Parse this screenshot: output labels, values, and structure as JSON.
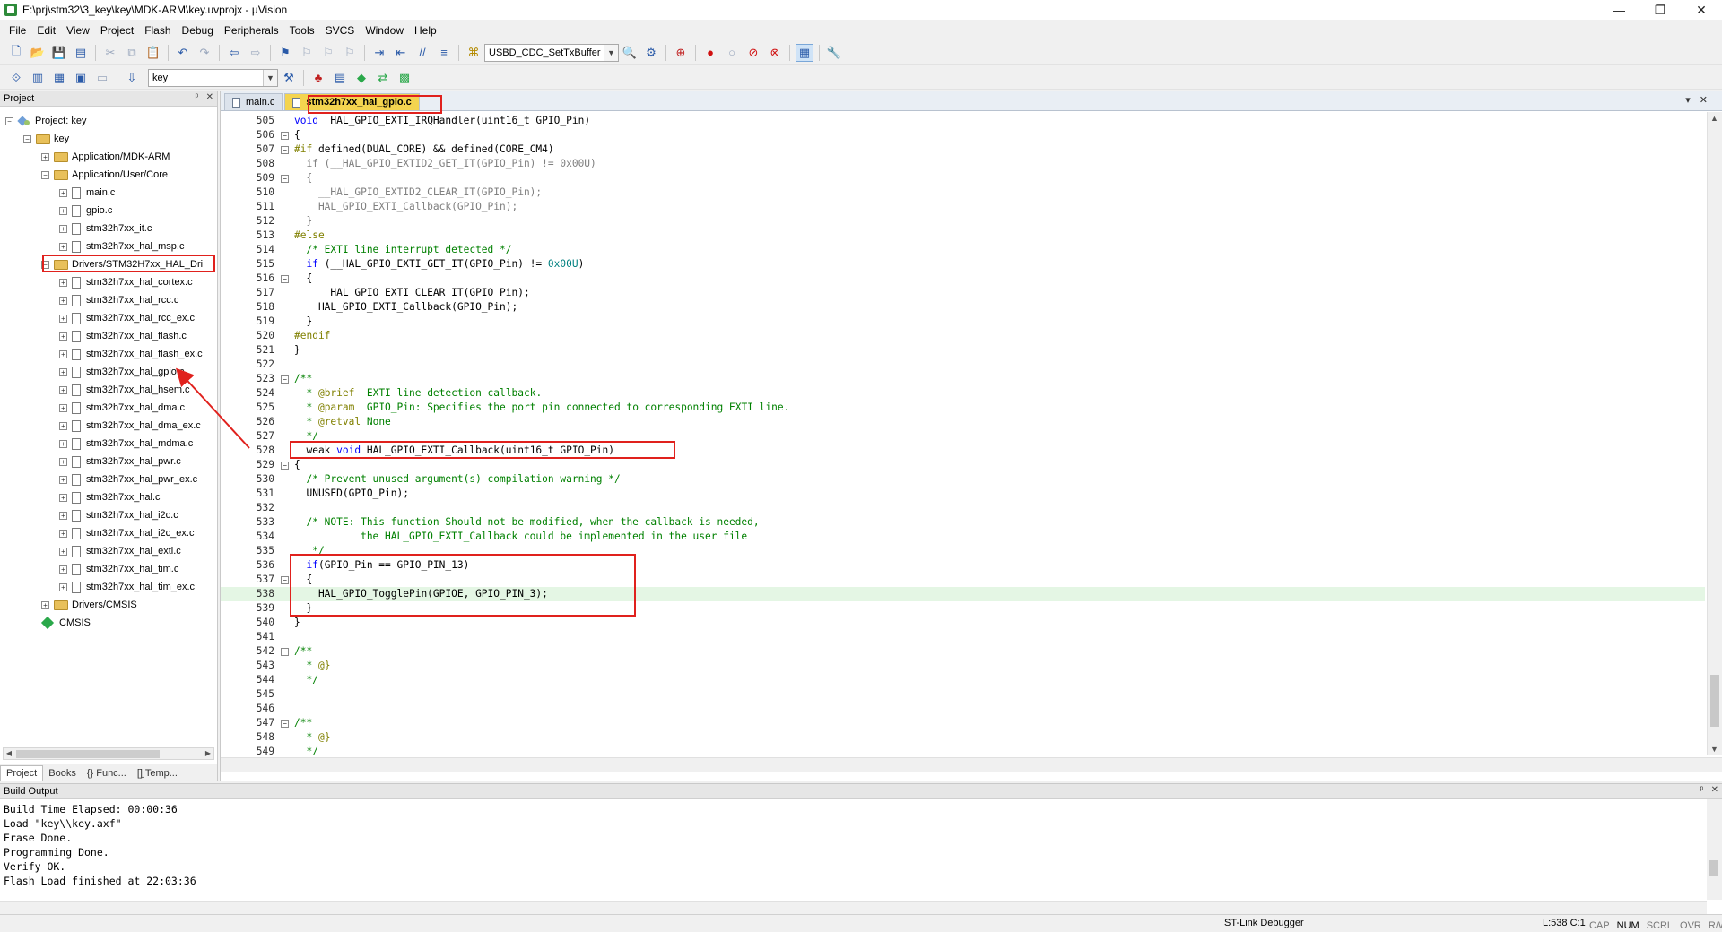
{
  "window": {
    "title": "E:\\prj\\stm32\\3_key\\key\\MDK-ARM\\key.uvprojx - µVision",
    "minimize": "—",
    "maximize": "❐",
    "close": "✕"
  },
  "menu": [
    "File",
    "Edit",
    "View",
    "Project",
    "Flash",
    "Debug",
    "Peripherals",
    "Tools",
    "SVCS",
    "Window",
    "Help"
  ],
  "toolbar": {
    "function_combo": "USBD_CDC_SetTxBuffer",
    "target_combo": "key"
  },
  "project_panel": {
    "title": "Project",
    "pin": "ᵖ",
    "close": "✕",
    "tree": [
      {
        "label": "Project: key",
        "type": "project",
        "level": 0,
        "expander": "−"
      },
      {
        "label": "key",
        "type": "target",
        "level": 1,
        "expander": "−"
      },
      {
        "label": "Application/MDK-ARM",
        "type": "folder",
        "level": 2,
        "expander": "+"
      },
      {
        "label": "Application/User/Core",
        "type": "folder",
        "level": 2,
        "expander": "−"
      },
      {
        "label": "main.c",
        "type": "file",
        "level": 3,
        "expander": "+"
      },
      {
        "label": "gpio.c",
        "type": "file",
        "level": 3,
        "expander": "+"
      },
      {
        "label": "stm32h7xx_it.c",
        "type": "file",
        "level": 3,
        "expander": "+"
      },
      {
        "label": "stm32h7xx_hal_msp.c",
        "type": "file",
        "level": 3,
        "expander": "+"
      },
      {
        "label": "Drivers/STM32H7xx_HAL_Dri",
        "type": "folder",
        "level": 2,
        "expander": "−"
      },
      {
        "label": "stm32h7xx_hal_cortex.c",
        "type": "file",
        "level": 3,
        "expander": "+"
      },
      {
        "label": "stm32h7xx_hal_rcc.c",
        "type": "file",
        "level": 3,
        "expander": "+"
      },
      {
        "label": "stm32h7xx_hal_rcc_ex.c",
        "type": "file",
        "level": 3,
        "expander": "+"
      },
      {
        "label": "stm32h7xx_hal_flash.c",
        "type": "file",
        "level": 3,
        "expander": "+"
      },
      {
        "label": "stm32h7xx_hal_flash_ex.c",
        "type": "file",
        "level": 3,
        "expander": "+"
      },
      {
        "label": "stm32h7xx_hal_gpio.c",
        "type": "file",
        "level": 3,
        "expander": "+"
      },
      {
        "label": "stm32h7xx_hal_hsem.c",
        "type": "file",
        "level": 3,
        "expander": "+"
      },
      {
        "label": "stm32h7xx_hal_dma.c",
        "type": "file",
        "level": 3,
        "expander": "+"
      },
      {
        "label": "stm32h7xx_hal_dma_ex.c",
        "type": "file",
        "level": 3,
        "expander": "+"
      },
      {
        "label": "stm32h7xx_hal_mdma.c",
        "type": "file",
        "level": 3,
        "expander": "+"
      },
      {
        "label": "stm32h7xx_hal_pwr.c",
        "type": "file",
        "level": 3,
        "expander": "+"
      },
      {
        "label": "stm32h7xx_hal_pwr_ex.c",
        "type": "file",
        "level": 3,
        "expander": "+"
      },
      {
        "label": "stm32h7xx_hal.c",
        "type": "file",
        "level": 3,
        "expander": "+"
      },
      {
        "label": "stm32h7xx_hal_i2c.c",
        "type": "file",
        "level": 3,
        "expander": "+"
      },
      {
        "label": "stm32h7xx_hal_i2c_ex.c",
        "type": "file",
        "level": 3,
        "expander": "+"
      },
      {
        "label": "stm32h7xx_hal_exti.c",
        "type": "file",
        "level": 3,
        "expander": "+"
      },
      {
        "label": "stm32h7xx_hal_tim.c",
        "type": "file",
        "level": 3,
        "expander": "+"
      },
      {
        "label": "stm32h7xx_hal_tim_ex.c",
        "type": "file",
        "level": 3,
        "expander": "+"
      },
      {
        "label": "Drivers/CMSIS",
        "type": "folder",
        "level": 2,
        "expander": "+"
      },
      {
        "label": "CMSIS",
        "type": "cmsis",
        "level": 2,
        "expander": ""
      }
    ],
    "tabs": [
      "Project",
      "Books",
      "{} Func...",
      "[]̱ Temp..."
    ]
  },
  "editor": {
    "tabs": [
      {
        "label": "main.c",
        "active": false
      },
      {
        "label": "stm32h7xx_hal_gpio.c",
        "active": true
      }
    ],
    "current_line": 538,
    "lines": [
      {
        "n": "505",
        "fold": "",
        "segs": [
          [
            "kw",
            "void"
          ],
          [
            "",
            "  HAL_GPIO_EXTI_IRQHandler(uint16_t GPIO_Pin)"
          ]
        ]
      },
      {
        "n": "506",
        "fold": "−",
        "segs": [
          [
            "",
            "{"
          ]
        ]
      },
      {
        "n": "507",
        "fold": "−",
        "segs": [
          [
            "pp",
            "#if"
          ],
          [
            "",
            " defined(DUAL_CORE) && defined(CORE_CM4)"
          ]
        ]
      },
      {
        "n": "508",
        "fold": "",
        "segs": [
          [
            "dimtxt",
            "  if (__HAL_GPIO_EXTID2_GET_IT(GPIO_Pin) != 0x00U)"
          ]
        ]
      },
      {
        "n": "509",
        "fold": "−",
        "segs": [
          [
            "dimtxt",
            "  {"
          ]
        ]
      },
      {
        "n": "510",
        "fold": "",
        "segs": [
          [
            "dimtxt",
            "    __HAL_GPIO_EXTID2_CLEAR_IT(GPIO_Pin);"
          ]
        ]
      },
      {
        "n": "511",
        "fold": "",
        "segs": [
          [
            "dimtxt",
            "    HAL_GPIO_EXTI_Callback(GPIO_Pin);"
          ]
        ]
      },
      {
        "n": "512",
        "fold": "",
        "segs": [
          [
            "dimtxt",
            "  }"
          ]
        ]
      },
      {
        "n": "513",
        "fold": "",
        "segs": [
          [
            "pp",
            "#else"
          ]
        ]
      },
      {
        "n": "514",
        "fold": "",
        "segs": [
          [
            "cm",
            "  /* EXTI line interrupt detected */"
          ]
        ]
      },
      {
        "n": "515",
        "fold": "",
        "segs": [
          [
            "kw",
            "  if"
          ],
          [
            "",
            " (__HAL_GPIO_EXTI_GET_IT(GPIO_Pin) != "
          ],
          [
            "num",
            "0x00U"
          ],
          [
            "",
            ")"
          ]
        ]
      },
      {
        "n": "516",
        "fold": "−",
        "segs": [
          [
            "",
            "  {"
          ]
        ]
      },
      {
        "n": "517",
        "fold": "",
        "segs": [
          [
            "",
            "    __HAL_GPIO_EXTI_CLEAR_IT(GPIO_Pin);"
          ]
        ]
      },
      {
        "n": "518",
        "fold": "",
        "segs": [
          [
            "",
            "    HAL_GPIO_EXTI_Callback(GPIO_Pin);"
          ]
        ]
      },
      {
        "n": "519",
        "fold": "",
        "segs": [
          [
            "",
            "  }"
          ]
        ]
      },
      {
        "n": "520",
        "fold": "",
        "segs": [
          [
            "pp",
            "#endif"
          ]
        ]
      },
      {
        "n": "521",
        "fold": "",
        "segs": [
          [
            "",
            "}"
          ]
        ]
      },
      {
        "n": "522",
        "fold": "",
        "segs": [
          [
            "",
            ""
          ]
        ]
      },
      {
        "n": "523",
        "fold": "−",
        "segs": [
          [
            "cm",
            "/**"
          ]
        ]
      },
      {
        "n": "524",
        "fold": "",
        "segs": [
          [
            "cm",
            "  * "
          ],
          [
            "pp",
            "@brief"
          ],
          [
            "cm",
            "  EXTI line detection callback."
          ]
        ]
      },
      {
        "n": "525",
        "fold": "",
        "segs": [
          [
            "cm",
            "  * "
          ],
          [
            "pp",
            "@param"
          ],
          [
            "cm",
            "  GPIO_Pin: Specifies the port pin connected to corresponding EXTI line."
          ]
        ]
      },
      {
        "n": "526",
        "fold": "",
        "segs": [
          [
            "cm",
            "  * "
          ],
          [
            "pp",
            "@retval"
          ],
          [
            "cm",
            " None"
          ]
        ]
      },
      {
        "n": "527",
        "fold": "",
        "segs": [
          [
            "cm",
            "  */"
          ]
        ]
      },
      {
        "n": "528",
        "fold": "",
        "segs": [
          [
            "",
            "  weak "
          ],
          [
            "kw",
            "void"
          ],
          [
            "",
            " HAL_GPIO_EXTI_Callback(uint16_t GPIO_Pin)"
          ]
        ]
      },
      {
        "n": "529",
        "fold": "−",
        "segs": [
          [
            "",
            "{"
          ]
        ]
      },
      {
        "n": "530",
        "fold": "",
        "segs": [
          [
            "cm",
            "  /* Prevent unused argument(s) compilation warning */"
          ]
        ]
      },
      {
        "n": "531",
        "fold": "",
        "segs": [
          [
            "",
            "  UNUSED(GPIO_Pin);"
          ]
        ]
      },
      {
        "n": "532",
        "fold": "",
        "segs": [
          [
            "",
            ""
          ]
        ]
      },
      {
        "n": "533",
        "fold": "",
        "segs": [
          [
            "cm",
            "  /* NOTE: This function Should not be modified, when the callback is needed,"
          ]
        ]
      },
      {
        "n": "534",
        "fold": "",
        "segs": [
          [
            "cm",
            "           the HAL_GPIO_EXTI_Callback could be implemented in the user file"
          ]
        ]
      },
      {
        "n": "535",
        "fold": "",
        "segs": [
          [
            "cm",
            "   */"
          ]
        ]
      },
      {
        "n": "536",
        "fold": "",
        "segs": [
          [
            "kw",
            "  if"
          ],
          [
            "",
            "(GPIO_Pin == GPIO_PIN_13)"
          ]
        ]
      },
      {
        "n": "537",
        "fold": "−",
        "segs": [
          [
            "",
            "  {"
          ]
        ]
      },
      {
        "n": "538",
        "fold": "",
        "segs": [
          [
            "",
            "    HAL_GPIO_TogglePin(GPIOE, GPIO_PIN_3);"
          ]
        ]
      },
      {
        "n": "539",
        "fold": "",
        "segs": [
          [
            "",
            "  }"
          ]
        ]
      },
      {
        "n": "540",
        "fold": "",
        "segs": [
          [
            "",
            "}"
          ]
        ]
      },
      {
        "n": "541",
        "fold": "",
        "segs": [
          [
            "",
            ""
          ]
        ]
      },
      {
        "n": "542",
        "fold": "−",
        "segs": [
          [
            "cm",
            "/**"
          ]
        ]
      },
      {
        "n": "543",
        "fold": "",
        "segs": [
          [
            "cm",
            "  * "
          ],
          [
            "pp",
            "@}"
          ]
        ]
      },
      {
        "n": "544",
        "fold": "",
        "segs": [
          [
            "cm",
            "  */"
          ]
        ]
      },
      {
        "n": "545",
        "fold": "",
        "segs": [
          [
            "",
            ""
          ]
        ]
      },
      {
        "n": "546",
        "fold": "",
        "segs": [
          [
            "",
            ""
          ]
        ]
      },
      {
        "n": "547",
        "fold": "−",
        "segs": [
          [
            "cm",
            "/**"
          ]
        ]
      },
      {
        "n": "548",
        "fold": "",
        "segs": [
          [
            "cm",
            "  * "
          ],
          [
            "pp",
            "@}"
          ]
        ]
      },
      {
        "n": "549",
        "fold": "",
        "segs": [
          [
            "cm",
            "  */"
          ]
        ]
      }
    ]
  },
  "build_output": {
    "title": "Build Output",
    "lines": [
      "Build Time Elapsed:  00:00:36",
      "Load \"key\\\\key.axf\"",
      "Erase Done.",
      "Programming Done.",
      "Verify OK.",
      "Flash Load finished at 22:03:36"
    ]
  },
  "status": {
    "debugger": "ST-Link Debugger",
    "position": "L:538 C:1",
    "indicators": [
      "CAP",
      "NUM",
      "SCRL",
      "OVR",
      "R/W"
    ],
    "active_indicator": "NUM"
  },
  "colors": {
    "keyword": "#0000ff",
    "comment": "#008000",
    "preprocessor": "#808000",
    "annotation": "#e0211d",
    "active_tab": "#f4d44f",
    "current_line": "#e4f6e4"
  }
}
